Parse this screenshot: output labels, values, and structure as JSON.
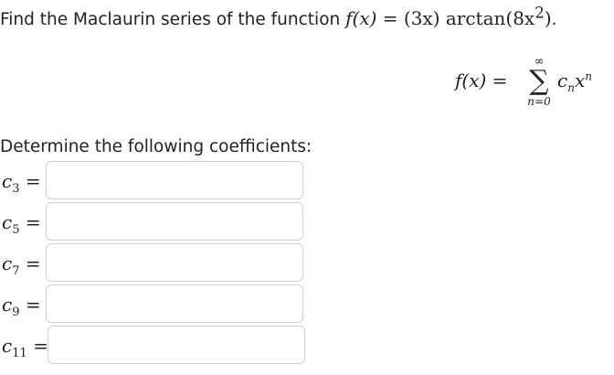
{
  "question": {
    "text": "Find the Maclaurin series of the function ",
    "function_lhs": "f(x)",
    "equals": " = ",
    "function_rhs_coef": "(3x)",
    "function_rhs_fn": " arctan",
    "function_rhs_arg": "(8x",
    "function_rhs_exp": "2",
    "function_rhs_close": ")",
    "period": "."
  },
  "series": {
    "lhs": "f(x) =",
    "sigma": "∑",
    "upper_limit": "∞",
    "lower_limit": "n=0",
    "coef": "c",
    "coef_sub": "n",
    "var": "x",
    "var_sup": "n"
  },
  "instructions": "Determine the following coefficients:",
  "coefficients": [
    {
      "name": "c",
      "index": "3",
      "equals": "=",
      "value": ""
    },
    {
      "name": "c",
      "index": "5",
      "equals": "=",
      "value": ""
    },
    {
      "name": "c",
      "index": "7",
      "equals": "=",
      "value": ""
    },
    {
      "name": "c",
      "index": "9",
      "equals": "=",
      "value": ""
    },
    {
      "name": "c",
      "index": "11",
      "equals": "=",
      "value": ""
    }
  ]
}
